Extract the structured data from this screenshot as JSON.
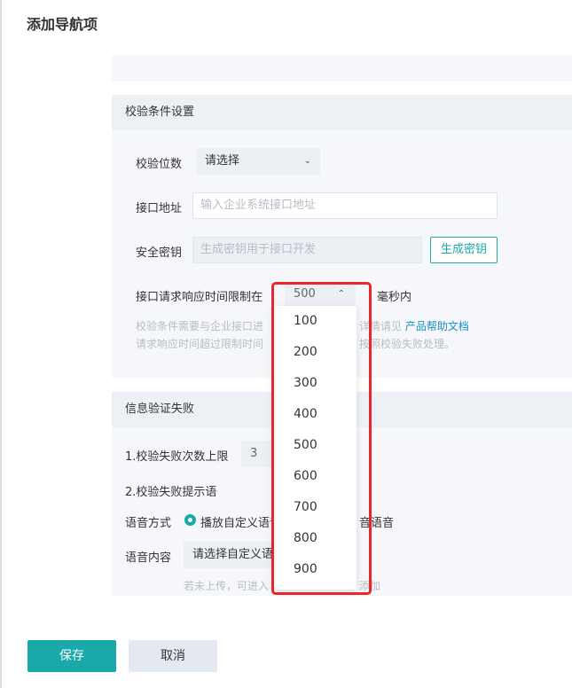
{
  "dialog": {
    "title": "添加导航项"
  },
  "verify_section": {
    "header": "校验条件设置",
    "digits_label": "校验位数",
    "digits_value": "请选择",
    "api_label": "接口地址",
    "api_placeholder": "输入企业系统接口地址",
    "key_label": "安全密钥",
    "key_placeholder": "生成密钥用于接口开发",
    "generate_key_button": "生成密钥",
    "timeout_label": "接口请求响应时间限制在",
    "timeout_value": "500",
    "timeout_suffix": "毫秒内",
    "hint_line1_a": "校验条件需要与企业接口进",
    "hint_line1_b": "详情请见",
    "hint_link": "产品帮助文档",
    "hint_line2_a": "请求响应时间超过限制时间",
    "hint_line2_b": "按照校验失败处理。"
  },
  "fail_section": {
    "header": "信息验证失败",
    "max_fail_label": "1.校验失败次数上限",
    "max_fail_value": "3",
    "prompt_label": "2.校验失败提示语",
    "voice_mode_label": "语音方式",
    "voice_mode_option1": "播放自定义语音",
    "voice_mode_option2_tail": "音语音",
    "voice_content_label": "语音内容",
    "voice_content_value": "请选择自定义语音",
    "upload_hint_a": "若未上传，可进入",
    "upload_hint_b": "添加"
  },
  "timeout_dropdown": {
    "options": [
      "100",
      "200",
      "300",
      "400",
      "500",
      "600",
      "700",
      "800",
      "900"
    ]
  },
  "footer": {
    "save": "保存",
    "cancel": "取消"
  },
  "colors": {
    "accent": "#1aa8a8",
    "highlight": "#e8262b",
    "link": "#1a8fc8"
  }
}
